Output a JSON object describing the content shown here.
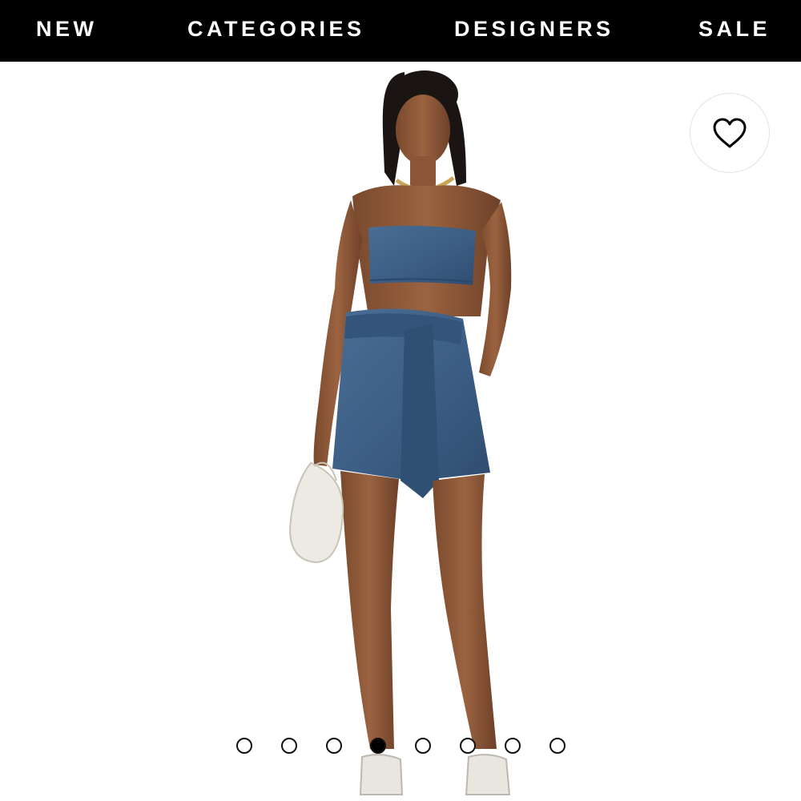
{
  "nav": {
    "items": [
      {
        "label": "NEW"
      },
      {
        "label": "CATEGORIES"
      },
      {
        "label": "DESIGNERS"
      },
      {
        "label": "SALE"
      }
    ],
    "background": "#000000",
    "text_color": "#ffffff"
  },
  "product": {
    "image_icon": "product-photo",
    "garment_color": "#3b5d83",
    "wishlist_icon": "heart-outline-icon"
  },
  "carousel": {
    "total_slides": 8,
    "active_index": 3
  }
}
